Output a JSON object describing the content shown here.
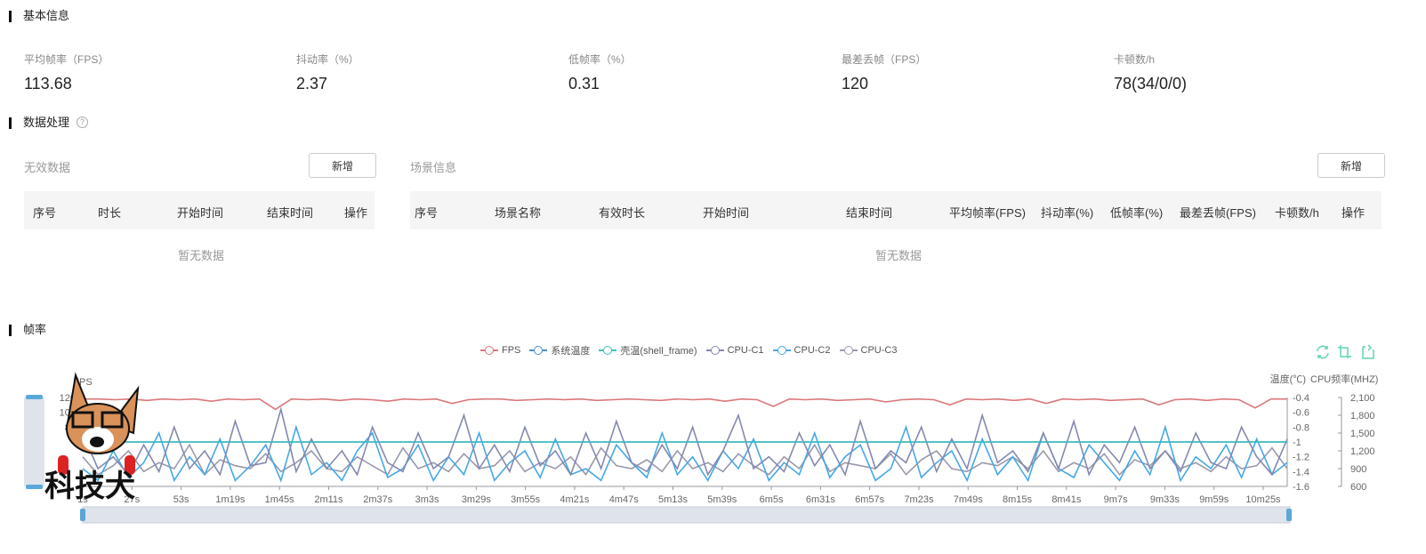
{
  "sections": {
    "basic": "基本信息",
    "processing": "数据处理",
    "framerate": "帧率"
  },
  "stats": [
    {
      "label": "平均帧率（FPS）",
      "value": "113.68"
    },
    {
      "label": "抖动率（%）",
      "value": "2.37"
    },
    {
      "label": "低帧率（%）",
      "value": "0.31"
    },
    {
      "label": "最差丢帧（FPS）",
      "value": "120"
    },
    {
      "label": "卡顿数/h",
      "value": "78(34/0/0)"
    }
  ],
  "invalid": {
    "title": "无效数据",
    "add": "新增",
    "columns": [
      "序号",
      "时长",
      "开始时间",
      "结束时间",
      "操作"
    ],
    "empty": "暂无数据"
  },
  "scene": {
    "title": "场景信息",
    "add": "新增",
    "columns": [
      "序号",
      "场景名称",
      "有效时长",
      "开始时间",
      "结束时间",
      "平均帧率(FPS)",
      "抖动率(%)",
      "低帧率(%)",
      "最差丢帧(FPS)",
      "卡顿数/h",
      "操作"
    ],
    "empty": "暂无数据"
  },
  "watermark": "科技犬",
  "chart_data": {
    "type": "line",
    "legend": [
      "FPS",
      "系统温度",
      "壳温(shell_frame)",
      "CPU-C1",
      "CPU-C2",
      "CPU-C3"
    ],
    "legend_position": "top-center",
    "y_left": {
      "label": "FPS",
      "range": [
        0,
        120
      ],
      "ticks": [
        "120",
        "100",
        "80"
      ]
    },
    "y_right1": {
      "label": "温度(℃)",
      "range": [
        -1.6,
        -0.4
      ],
      "ticks": [
        "-0.4",
        "-0.6",
        "-0.8",
        "-1",
        "-1.2",
        "-1.4",
        "-1.6"
      ]
    },
    "y_right2": {
      "label": "CPU频率(MHZ)",
      "range": [
        600,
        2100
      ],
      "ticks": [
        "2,100",
        "1,800",
        "1,500",
        "1,200",
        "900",
        "600"
      ]
    },
    "x_ticks": [
      "1s",
      "27s",
      "53s",
      "1m19s",
      "1m45s",
      "2m11s",
      "2m37s",
      "3m3s",
      "3m29s",
      "3m55s",
      "4m21s",
      "4m47s",
      "5m13s",
      "5m39s",
      "6m5s",
      "6m31s",
      "6m57s",
      "7m23s",
      "7m49s",
      "8m15s",
      "8m41s",
      "9m7s",
      "9m33s",
      "9m59s",
      "10m25s"
    ],
    "colors": {
      "FPS": "#d9777b",
      "系统温度": "#4a8fd0",
      "壳温(shell_frame)": "#3cc0c0",
      "CPU-C1": "#8489b0",
      "CPU-C2": "#46a8e6",
      "CPU-C3": "#9999ad"
    },
    "series": {
      "FPS": [
        118,
        118,
        117,
        118,
        116,
        118,
        117,
        118,
        115,
        118,
        117,
        118,
        104,
        118,
        117,
        118,
        116,
        118,
        117,
        115,
        118,
        117,
        118,
        112,
        117,
        118,
        118,
        116,
        117,
        118,
        117,
        118,
        116,
        117,
        118,
        117,
        116,
        118,
        117,
        118,
        115,
        118,
        117,
        108,
        118,
        117,
        118,
        116,
        117,
        118,
        114,
        117,
        118,
        117,
        110,
        118,
        117,
        118,
        116,
        118,
        112,
        118,
        117,
        118,
        116,
        117,
        118,
        110,
        117,
        118,
        116,
        118,
        117,
        106,
        118,
        118
      ],
      "系统温度": [
        -1,
        -1
      ],
      "壳温(shell_frame)": [
        -1,
        -1
      ],
      "CPU-C1": [
        1500,
        900,
        1100,
        800,
        1300,
        850,
        1600,
        900,
        1200,
        800,
        1700,
        950,
        1000,
        1900,
        850,
        1400,
        900,
        1200,
        800,
        1600,
        1000,
        850,
        1500,
        900,
        1100,
        1800,
        900,
        1300,
        850,
        1600,
        950,
        1200,
        800,
        1500,
        900,
        1700,
        1000,
        850,
        1300,
        900,
        1600,
        800,
        1200,
        1800,
        900,
        1100,
        850,
        1500,
        950,
        1300,
        800,
        1700,
        900,
        1200,
        1000,
        1600,
        850,
        1400,
        900,
        1800,
        1000,
        1200,
        850,
        1500,
        900,
        1700,
        800,
        1300,
        1000,
        1600,
        900,
        1200,
        850,
        1500,
        1000,
        900,
        1600,
        1100,
        800,
        1400
      ],
      "CPU-C2": [
        900,
        700,
        1200,
        750,
        1000,
        1500,
        700,
        1100,
        800,
        1400,
        700,
        950,
        1300,
        700,
        1600,
        800,
        1000,
        700,
        1200,
        1500,
        750,
        900,
        1300,
        700,
        1100,
        800,
        1500,
        700,
        1000,
        1200,
        750,
        1400,
        800,
        900,
        700,
        1300,
        1000,
        750,
        1500,
        800,
        1100,
        700,
        1200,
        900,
        1400,
        700,
        1000,
        800,
        1500,
        750,
        1100,
        1300,
        700,
        900,
        1600,
        750,
        1000,
        1200,
        700,
        1400,
        800,
        1100,
        700,
        1500,
        900,
        750,
        1300,
        1000,
        700,
        1200,
        800,
        1600,
        700,
        1100,
        900,
        1300,
        750,
        1400,
        800,
        1000
      ],
      "CPU-C3": [
        1100,
        800,
        950,
        1200,
        850,
        1000,
        900,
        1300,
        800,
        1050,
        950,
        900,
        1150,
        850,
        1000,
        1200,
        900,
        850,
        1100,
        950,
        800,
        1250,
        900,
        1000,
        850,
        1150,
        900,
        950,
        1200,
        850,
        1000,
        900,
        1100,
        800,
        1250,
        950,
        900,
        1050,
        850,
        1200,
        900,
        1000,
        850,
        1150,
        950,
        800,
        1100,
        900,
        1300,
        850,
        1000,
        950,
        900,
        1150,
        800,
        1050,
        1200,
        900,
        850,
        1000,
        950,
        1100,
        900,
        1200,
        850,
        1000,
        900,
        1150,
        800,
        1050,
        950,
        1200,
        900,
        1000,
        850,
        1100,
        900,
        950,
        1250,
        900
      ]
    }
  }
}
